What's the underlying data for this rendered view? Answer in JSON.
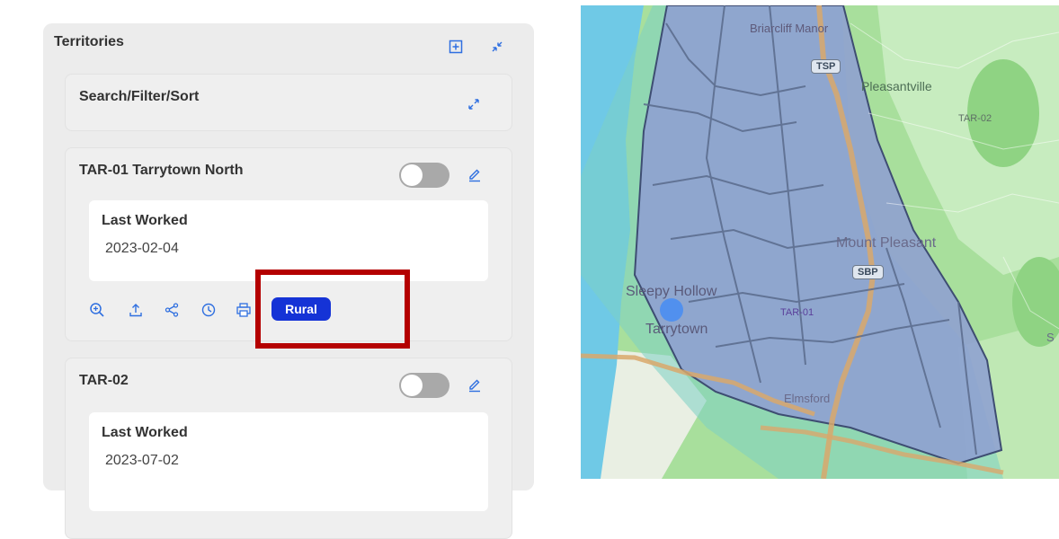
{
  "territories_panel": {
    "title": "Territories",
    "search_section_title": "Search/Filter/Sort"
  },
  "territories": [
    {
      "title": "TAR-01 Tarrytown North",
      "last_worked_label": "Last Worked",
      "last_worked_value": "2023-02-04",
      "toggle_on": false,
      "tag": "Rural"
    },
    {
      "title": "TAR-02",
      "last_worked_label": "Last Worked",
      "last_worked_value": "2023-07-02",
      "toggle_on": false
    }
  ],
  "card_actions": [
    "zoom-in-icon",
    "upload-icon",
    "share-icon",
    "history-icon",
    "print-icon"
  ],
  "colors": {
    "accent": "#2f6fe0",
    "badge": "#1533d6",
    "highlight": "#b40000",
    "territory_fill": "#8e9fd2"
  },
  "map": {
    "place_labels": {
      "briarcliff_manor": "Briarcliff Manor",
      "pleasantville": "Pleasantville",
      "mount_pleasant": "Mount Pleasant",
      "sleepy_hollow": "Sleepy Hollow",
      "tarrytown": "Tarrytown",
      "elmsford": "Elmsford",
      "edge_s": "S"
    },
    "territory_labels": {
      "tar01": "TAR-01",
      "tar02": "TAR-02"
    },
    "road_shields": {
      "tsp": "TSP",
      "sbp": "SBP"
    }
  }
}
